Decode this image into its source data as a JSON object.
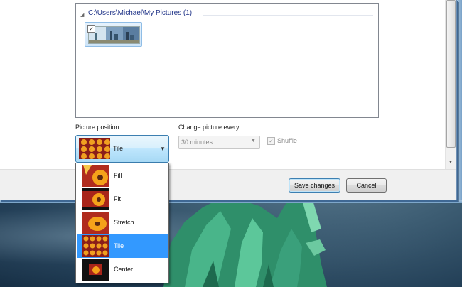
{
  "folder": {
    "path": "C:\\Users\\Michael\\My Pictures (1)"
  },
  "picture_position": {
    "label": "Picture position:",
    "selected": "Tile",
    "options": [
      {
        "label": "Fill",
        "icon": "flower-fill-thumbnail"
      },
      {
        "label": "Fit",
        "icon": "flower-fit-thumbnail"
      },
      {
        "label": "Stretch",
        "icon": "flower-stretch-thumbnail"
      },
      {
        "label": "Tile",
        "icon": "flower-tile-thumbnail",
        "selected": true
      },
      {
        "label": "Center",
        "icon": "flower-center-thumbnail"
      }
    ]
  },
  "change_picture": {
    "label": "Change picture every:",
    "value": "30 minutes",
    "shuffle_label": "Shuffle",
    "shuffle_checked": true,
    "disabled": true
  },
  "buttons": {
    "save": "Save changes",
    "cancel": "Cancel"
  },
  "colors": {
    "selection": "#3399ff",
    "link": "#1e3287"
  }
}
